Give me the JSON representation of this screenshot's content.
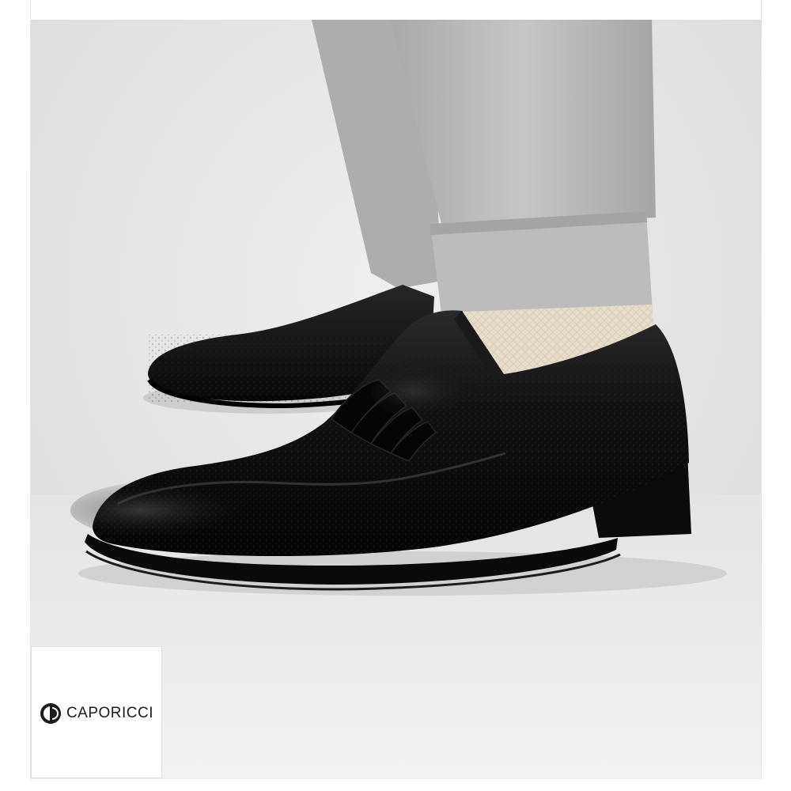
{
  "brand": {
    "name": "CAPORICCI",
    "logo_icon": "caporicci-monogram-icon"
  },
  "product_image": {
    "subject_icon": "black-ostrich-loafer-photo"
  },
  "colors": {
    "background": "#ffffff",
    "studio_backdrop": "#e6e6e6",
    "trousers": "#b9b9b9",
    "sock": "#e8dccb",
    "shoe": "#0d0d0d"
  }
}
